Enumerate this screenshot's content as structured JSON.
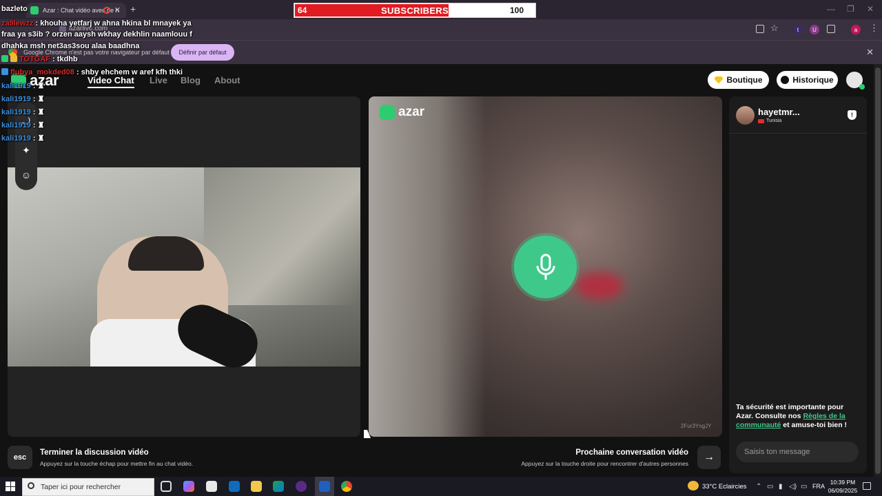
{
  "browser": {
    "tab_title": "Azar : Chat vidéo avec de n",
    "url": "azarlive.com",
    "info_message": "Google Chrome n'est pas votre navigateur par défaut",
    "default_button": "Définir par défaut",
    "extensions": [
      "t",
      "U",
      "a"
    ]
  },
  "nav": {
    "brand": "azar",
    "items": [
      "Video Chat",
      "Live",
      "Blog",
      "About"
    ],
    "shop_label": "Boutique",
    "history_label": "Historique"
  },
  "remote": {
    "brand": "azar",
    "watermark": "2Fur3YngJY"
  },
  "peer": {
    "name": "hayetmr...",
    "country": "Tunisia"
  },
  "chat": {
    "safety_pre": "Ta sécurité est importante pour Azar. Consulte nos ",
    "safety_link": "Règles de la communauté",
    "safety_post": " et amuse-toi bien !",
    "placeholder": "Saisis ton message"
  },
  "footer": {
    "esc_key": "esc",
    "end_title": "Terminer la discussion vidéo",
    "end_sub": "Appuyez sur la touche échap pour mettre fin au chat vidéo.",
    "next_title": "Prochaine conversation vidéo",
    "next_sub": "Appuyez sur la touche droite pour rencontrer d'autres personnes",
    "next_key": "→"
  },
  "overlay": {
    "subscribers_current": "64",
    "subscribers_label": "SUBSCRIBERS",
    "subscribers_goal": "100",
    "subscribers_progress": 0.64,
    "stream_chat": [
      {
        "user": "",
        "text": "bazleto"
      },
      {
        "user": "za9lewzz",
        "text": ": khouha yetfarj w ahna hkina bl mnayek ya"
      },
      {
        "user": "",
        "text": "fraa ya s3ib ? orzen aaysh wkhay dekhlin naamlouu f"
      },
      {
        "user": "",
        "text": "dhahka msh net3as3sou alaa baadhna"
      },
      {
        "user": "TOTGAF",
        "text": ": tkdhb"
      },
      {
        "user": "flubya_mokded08",
        "text": ": shby ehchem w aref kfh thki"
      },
      {
        "user": "kali1919",
        "text": ":"
      },
      {
        "user": "kali1919",
        "text": ":"
      },
      {
        "user": "kali1919",
        "text": ":"
      },
      {
        "user": "kali1919",
        "text": ":"
      },
      {
        "user": "kali1919",
        "text": ":"
      }
    ]
  },
  "taskbar": {
    "search_placeholder": "Taper ici pour rechercher",
    "weather": "33°C  Eclaircies",
    "language": "FRA",
    "time": "10:39 PM",
    "date": "06/09/2025"
  }
}
